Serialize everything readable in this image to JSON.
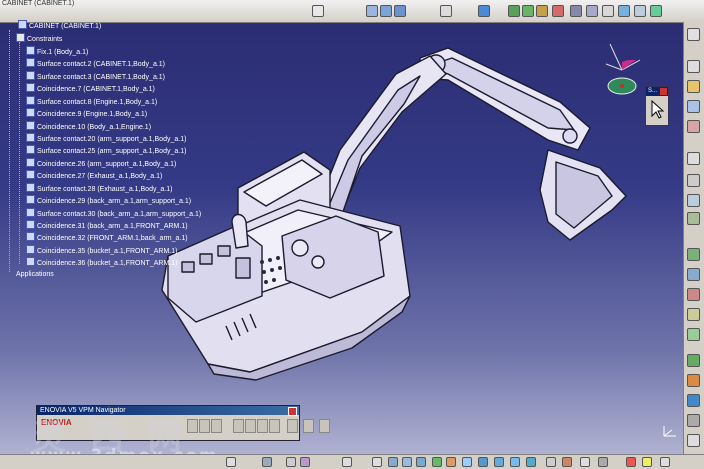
{
  "title": "CABINET (CABINET.1)",
  "tree": {
    "root_label": "CABINET (CABINET.1)",
    "constraints_label": "Constraints",
    "items": [
      "Fix.1 (Body_a.1)",
      "Surface contact.2 (CABINET.1,Body_a.1)",
      "Surface contact.3 (CABINET.1,Body_a.1)",
      "Coincidence.7 (CABINET.1,Body_a.1)",
      "Surface contact.8 (Engine.1,Body_a.1)",
      "Coincidence.9 (Engine.1,Body_a.1)",
      "Coincidence.10 (Body_a.1,Engine.1)",
      "Surface contact.20 (arm_support_a.1,Body_a.1)",
      "Surface contact.25 (arm_support_a.1,Body_a.1)",
      "Coincidence.26 (arm_support_a.1,Body_a.1)",
      "Coincidence.27 (Exhaust_a.1,Body_a.1)",
      "Surface contact.28 (Exhaust_a.1,Body_a.1)",
      "Coincidence.29 (back_arm_a.1,arm_support_a.1)",
      "Surface contact.30 (back_arm_a.1,arm_support_a.1)",
      "Coincidence.31 (back_arm_a.1,FRONT_ARM.1)",
      "Coincidence.32 (FRONT_ARM.1,back_arm_a.1)",
      "Coincidence.35 (bucket_a.1,FRONT_ARM.1)",
      "Coincidence.36 (bucket_a.1,FRONT_ARM.1)"
    ],
    "applications_label": "Applications"
  },
  "navigator": {
    "title": "ENOVIA V5 VPM Navigator",
    "logo": "ENOVIA"
  },
  "mini_panel": {
    "title": "S..."
  },
  "watermark": {
    "chars": "灵 西 网",
    "url": "www.3dmox.com"
  },
  "colors": {
    "background": "#353a86",
    "part_fill": "#e4e2f2",
    "part_edge": "#1b1b2e",
    "title_bar": "#0a246a"
  }
}
